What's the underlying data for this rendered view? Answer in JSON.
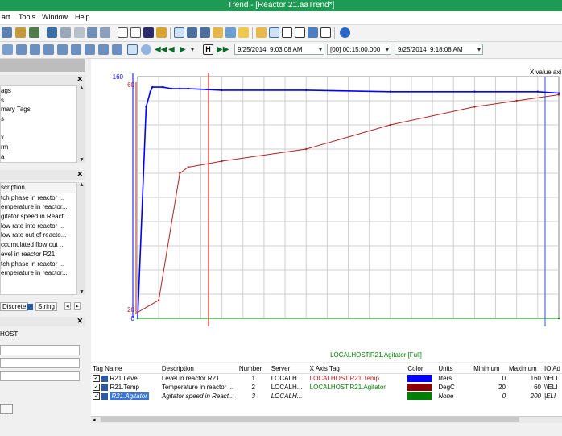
{
  "window": {
    "title": "Trend - [Reactor 21.aaTrend*]"
  },
  "menu": [
    "art",
    "Tools",
    "Window",
    "Help"
  ],
  "toolbar2": {
    "start_date": "9/25/2014",
    "start_time": "9:03:08 AM",
    "duration": "[00] 00:15:00.000",
    "end_date": "9/25/2014",
    "end_time": "9:18:08 AM"
  },
  "tag_tree": {
    "items": [
      "ags",
      "s",
      "mary Tags",
      "s",
      "",
      "x",
      "rm",
      "a"
    ]
  },
  "tag_list": {
    "header": "scription",
    "items": [
      "tch phase in reactor ...",
      "emperature in reactor...",
      "gitator speed in React...",
      "low rate into reactor ...",
      "low rate out of reacto...",
      "ccumulated flow out ...",
      "evel in reactor R21",
      "tch phase in reactor ...",
      "emperature in reactor..."
    ]
  },
  "tabs": [
    "Discrete",
    "String"
  ],
  "server": {
    "label": "HOST"
  },
  "chart": {
    "x_axis_title": "X value axi",
    "bottom_label": "LOCALHOST:R21.Agitator [Full]",
    "left_axis_max": "160",
    "left_axis_max2": "60",
    "left_axis_min2": "20",
    "left_axis_min": "0"
  },
  "chart_data": {
    "type": "line",
    "xlabel": "",
    "ylabel": "",
    "series": [
      {
        "name": "R21.Level",
        "color": "#0000ff",
        "ylim": [
          0,
          160
        ],
        "x": [
          0.0,
          0.02,
          0.03,
          0.035,
          0.06,
          0.08,
          0.1,
          0.12,
          0.2,
          0.4,
          0.6,
          0.8,
          0.95,
          1.0
        ],
        "y": [
          0,
          140,
          150,
          153,
          153,
          152,
          152,
          152,
          151,
          151,
          150,
          150,
          150,
          149
        ]
      },
      {
        "name": "R21.Temp",
        "color": "#b22222",
        "ylim": [
          20,
          60
        ],
        "x": [
          0.0,
          0.05,
          0.1,
          0.12,
          0.2,
          0.4,
          0.6,
          0.8,
          0.9,
          1.0
        ],
        "y": [
          21,
          23,
          44,
          45,
          46,
          48,
          52,
          55,
          56,
          57
        ]
      },
      {
        "name": "R21.Agitator",
        "color": "#008000",
        "ylim": [
          0,
          200
        ],
        "x": [
          0.0,
          1.0
        ],
        "y": [
          0,
          0
        ]
      }
    ]
  },
  "legend": {
    "headers": [
      "Tag Name",
      "Description",
      "Number",
      "Server",
      "X Axis Tag",
      "Color",
      "Units",
      "Minimum",
      "Maximum",
      "IO Ad"
    ],
    "rows": [
      {
        "tag": "R21.Level",
        "desc": "Level in reactor R21",
        "num": "1",
        "server": "LOCALH...",
        "xtag": "LOCALHOST:R21.Temp",
        "color": "#0000ff",
        "units": "liters",
        "min": "0",
        "max": "160",
        "io": "\\\\ELI"
      },
      {
        "tag": "R21.Temp",
        "desc": "Temperature in reactor ...",
        "num": "2",
        "server": "LOCALH...",
        "xtag": "LOCALHOST:R21.Agitator",
        "color": "#8b0000",
        "units": "DegC",
        "min": "20",
        "max": "60",
        "io": "\\\\ELI"
      },
      {
        "tag": "R21.Agitator",
        "desc": "Agitator speed in React...",
        "num": "3",
        "server": "LOCALH...",
        "xtag": "",
        "color": "#008000",
        "units": "None",
        "min": "0",
        "max": "200",
        "io": "|ELI"
      }
    ]
  }
}
